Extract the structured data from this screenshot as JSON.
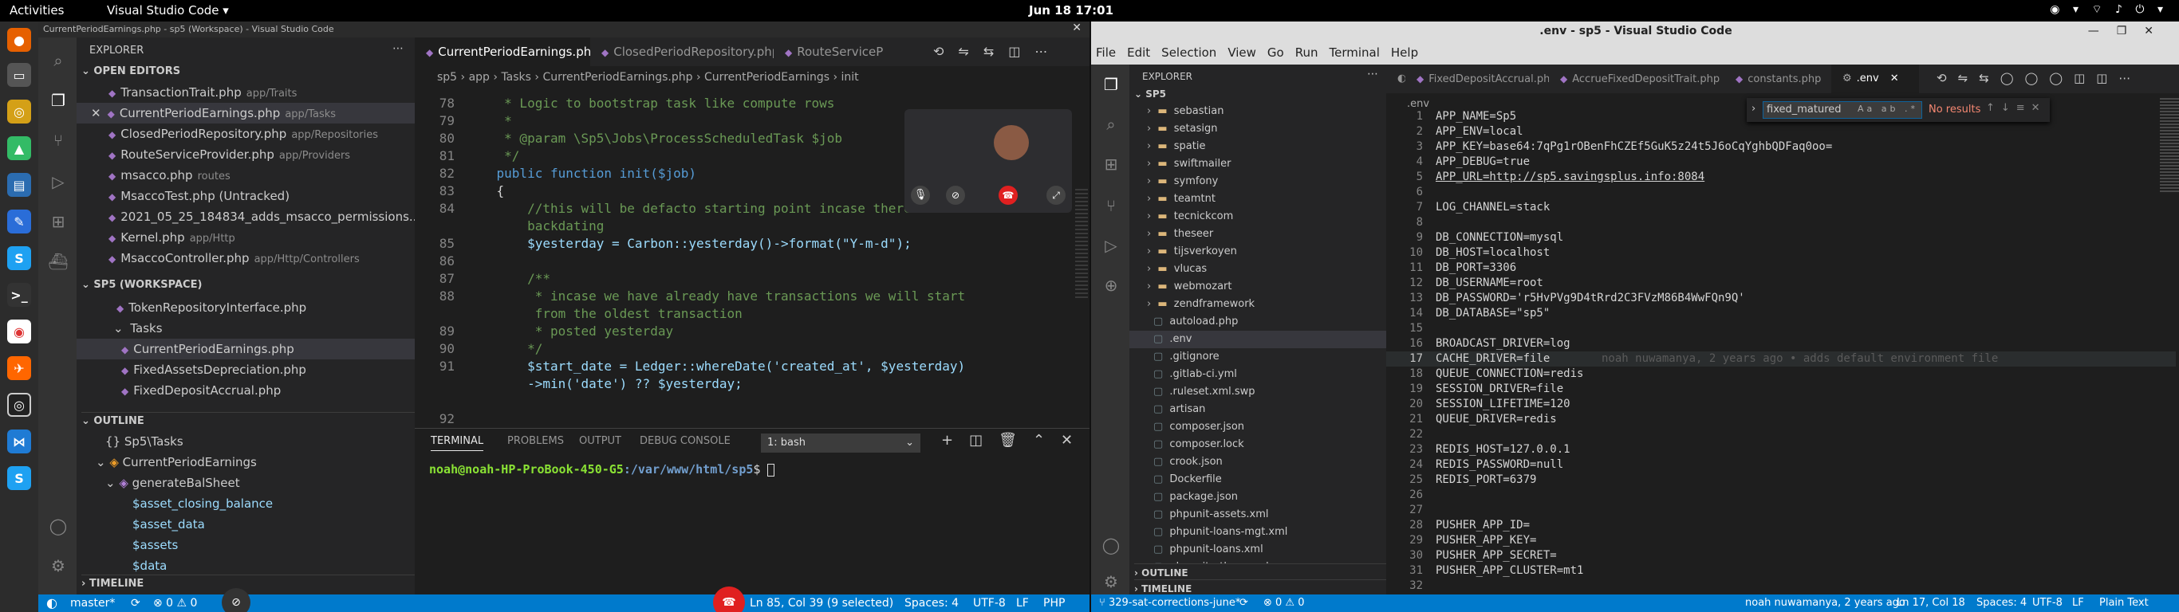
{
  "topbar": {
    "activities": "Activities",
    "app": "Visual Studio Code ▾",
    "clock": "Jun 18  17:01",
    "tray": "◉ ▾ ⌔ ♪ ⏻ ▾"
  },
  "left": {
    "title": "CurrentPeriodEarnings.php - sp5 (Workspace) - Visual Studio Code",
    "explorer": "EXPLORER",
    "open_editors": "OPEN EDITORS",
    "open_files": [
      {
        "name": "TransactionTrait.php",
        "path": "app/Traits",
        "mark": ""
      },
      {
        "name": "CurrentPeriodEarnings.php",
        "path": "app/Tasks",
        "mark": "✕"
      },
      {
        "name": "ClosedPeriodRepository.php",
        "path": "app/Repositories",
        "mark": ""
      },
      {
        "name": "RouteServiceProvider.php",
        "path": "app/Providers",
        "mark": ""
      },
      {
        "name": "msacco.php",
        "path": "routes",
        "mark": ""
      },
      {
        "name": "MsaccoTest.php (Untracked)",
        "path": "",
        "mark": ""
      },
      {
        "name": "2021_05_25_184834_adds_msacco_permissions...",
        "path": "",
        "mark": ""
      },
      {
        "name": "Kernel.php",
        "path": "app/Http",
        "mark": ""
      },
      {
        "name": "MsaccoController.php",
        "path": "app/Http/Controllers",
        "mark": ""
      }
    ],
    "workspace": "SP5 (WORKSPACE)",
    "ws_items": [
      "TokenRepositoryInterface.php",
      "Tasks",
      "CurrentPeriodEarnings.php",
      "FixedAssetsDepreciation.php",
      "FixedDepositAccrual.php"
    ],
    "outline": "OUTLINE",
    "outline_items": [
      "{} Sp5\\Tasks",
      "CurrentPeriodEarnings",
      "generateBalSheet",
      "$asset_closing_balance",
      "$asset_data",
      "$assets",
      "$data"
    ],
    "timeline": "TIMELINE",
    "tabs": [
      "CurrentPeriodEarnings.php",
      "ClosedPeriodRepository.php",
      "RouteServiceP"
    ],
    "breadcrumb": "sp5 › app › Tasks › CurrentPeriodEarnings.php › CurrentPeriodEarnings › init",
    "code": [
      {
        "n": "78",
        "t": "     * Logic to bootstrap task like compute rows",
        "c": "c-com"
      },
      {
        "n": "79",
        "t": "     *",
        "c": "c-com"
      },
      {
        "n": "80",
        "t": "     * @param \\Sp5\\Jobs\\ProcessScheduledTask $job",
        "c": "c-com"
      },
      {
        "n": "81",
        "t": "     */",
        "c": "c-com"
      },
      {
        "n": "82",
        "t": "    public function init($job)",
        "c": "c-kw"
      },
      {
        "n": "83",
        "t": "    {",
        "c": "c-plain"
      },
      {
        "n": "84",
        "t": "        //this will be defacto starting point incase there is no",
        "c": "c-com"
      },
      {
        "n": "",
        "t": "        backdating",
        "c": "c-com"
      },
      {
        "n": "85",
        "t": "        $yesterday = Carbon::yesterday()->format(\"Y-m-d\");",
        "c": "c-var"
      },
      {
        "n": "86",
        "t": "",
        "c": "c-plain"
      },
      {
        "n": "87",
        "t": "        /**",
        "c": "c-com"
      },
      {
        "n": "88",
        "t": "         * incase we have already have transactions we will start",
        "c": "c-com"
      },
      {
        "n": "",
        "t": "         from the oldest transaction",
        "c": "c-com"
      },
      {
        "n": "89",
        "t": "         * posted yesterday",
        "c": "c-com"
      },
      {
        "n": "90",
        "t": "        */",
        "c": "c-com"
      },
      {
        "n": "91",
        "t": "        $start_date = Ledger::whereDate('created_at', $yesterday)",
        "c": "c-var"
      },
      {
        "n": "",
        "t": "        ->min('date') ?? $yesterday;",
        "c": "c-var"
      },
      {
        "n": "",
        "t": "",
        "c": "c-plain"
      },
      {
        "n": "92",
        "t": "",
        "c": "c-plain"
      }
    ],
    "panel_tabs": [
      "TERMINAL",
      "PROBLEMS",
      "OUTPUT",
      "DEBUG CONSOLE"
    ],
    "terminal_select": "1: bash",
    "prompt_user": "noah@noah-HP-ProBook-450-G5",
    "prompt_path": ":/var/www/html/sp5",
    "prompt_end": "$ ",
    "status": {
      "branch": "master*",
      "sync": "⟳",
      "problems": "⊗ 0  ⚠ 0",
      "position": "Ln 85, Col 39 (9 selected)",
      "spaces": "Spaces: 4",
      "enc": "UTF-8",
      "eol": "LF",
      "lang": "PHP"
    }
  },
  "right": {
    "title": ".env - sp5 - Visual Studio Code",
    "menu": [
      "File",
      "Edit",
      "Selection",
      "View",
      "Go",
      "Run",
      "Terminal",
      "Help"
    ],
    "tabs": [
      "FixedDepositAccrual.php",
      "AccrueFixedDepositTrait.php",
      "constants.php",
      ".env"
    ],
    "breadcrumb": ".env",
    "explorer": "EXPLORER",
    "root": "SP5",
    "folders": [
      "sebastian",
      "setasign",
      "spatie",
      "swiftmailer",
      "symfony",
      "teamtnt",
      "tecnickcom",
      "theseer",
      "tijsverkoyen",
      "vlucas",
      "webmozart",
      "zendframework"
    ],
    "files": [
      "autoload.php",
      ".env",
      ".gitignore",
      ".gitlab-ci.yml",
      ".ruleset.xml.swp",
      "artisan",
      "composer.json",
      "composer.lock",
      "crook.json",
      "Dockerfile",
      "package.json",
      "phpunit-assets.xml",
      "phpunit-loans-mgt.xml",
      "phpunit-loans.xml",
      "phpunit-others.xml"
    ],
    "outline": "OUTLINE",
    "timeline": "TIMELINE",
    "find_value": "fixed_matured",
    "find_result": "No results",
    "blame": "noah nuwamanya, 2 years ago • adds default environment file",
    "env": [
      {
        "n": "1",
        "t": "APP_NAME=Sp5"
      },
      {
        "n": "2",
        "t": "APP_ENV=local"
      },
      {
        "n": "3",
        "t": "APP_KEY=base64:7qPg1rOBenFhCZEf5GuK5z24t5J6oCqYghbQDFaq0oo="
      },
      {
        "n": "4",
        "t": "APP_DEBUG=true"
      },
      {
        "n": "5",
        "t": "APP_URL=http://sp5.savingsplus.info:8084"
      },
      {
        "n": "6",
        "t": ""
      },
      {
        "n": "7",
        "t": "LOG_CHANNEL=stack"
      },
      {
        "n": "8",
        "t": ""
      },
      {
        "n": "9",
        "t": "DB_CONNECTION=mysql"
      },
      {
        "n": "10",
        "t": "DB_HOST=localhost"
      },
      {
        "n": "11",
        "t": "DB_PORT=3306"
      },
      {
        "n": "12",
        "t": "DB_USERNAME=root"
      },
      {
        "n": "13",
        "t": "DB_PASSWORD='r5HvPVg9D4tRrd2C3FVzM86B4WwFQn9Q'"
      },
      {
        "n": "14",
        "t": "DB_DATABASE=\"sp5\""
      },
      {
        "n": "15",
        "t": ""
      },
      {
        "n": "16",
        "t": "BROADCAST_DRIVER=log"
      },
      {
        "n": "17",
        "t": "CACHE_DRIVER=file"
      },
      {
        "n": "18",
        "t": "QUEUE_CONNECTION=redis"
      },
      {
        "n": "19",
        "t": "SESSION_DRIVER=file"
      },
      {
        "n": "20",
        "t": "SESSION_LIFETIME=120"
      },
      {
        "n": "21",
        "t": "QUEUE_DRIVER=redis"
      },
      {
        "n": "22",
        "t": ""
      },
      {
        "n": "23",
        "t": "REDIS_HOST=127.0.0.1"
      },
      {
        "n": "24",
        "t": "REDIS_PASSWORD=null"
      },
      {
        "n": "25",
        "t": "REDIS_PORT=6379"
      },
      {
        "n": "26",
        "t": ""
      },
      {
        "n": "27",
        "t": ""
      },
      {
        "n": "28",
        "t": "PUSHER_APP_ID="
      },
      {
        "n": "29",
        "t": "PUSHER_APP_KEY="
      },
      {
        "n": "30",
        "t": "PUSHER_APP_SECRET="
      },
      {
        "n": "31",
        "t": "PUSHER_APP_CLUSTER=mt1"
      },
      {
        "n": "32",
        "t": ""
      }
    ],
    "status": {
      "branch": "329-sat-corrections-june*",
      "problems": "⊗ 0  ⚠ 0",
      "blame": "noah nuwamanya, 2 years ago",
      "position": "Ln 17, Col 18",
      "spaces": "Spaces: 4",
      "enc": "UTF-8",
      "eol": "LF",
      "lang": "Plain Text"
    }
  }
}
